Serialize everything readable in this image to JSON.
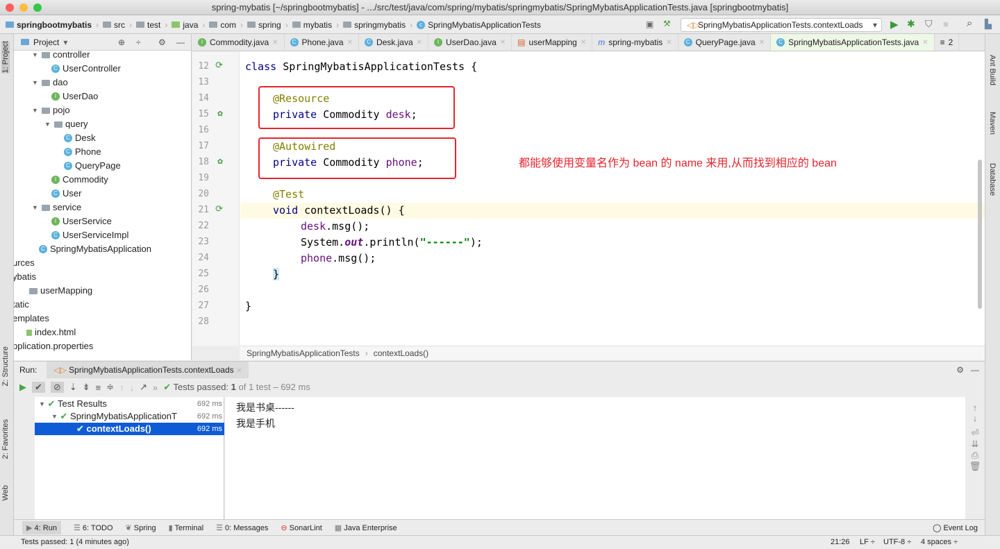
{
  "window": {
    "title": "spring-mybatis [~/springbootmybatis] - .../src/test/java/com/spring/mybatis/springmybatis/SpringMybatisApplicationTests.java [springbootmybatis]"
  },
  "nav": {
    "crumbs": [
      "springbootmybatis",
      "src",
      "test",
      "java",
      "com",
      "spring",
      "mybatis",
      "springmybatis",
      "SpringMybatisApplicationTests"
    ],
    "run_config": "SpringMybatisApplicationTests.contextLoads"
  },
  "left_strip": {
    "project": "1: Project",
    "structure": "Z: Structure",
    "favorites": "2: Favorites",
    "web": "Web"
  },
  "right_strip": {
    "ant": "Ant Build",
    "maven": "Maven",
    "database": "Database"
  },
  "project": {
    "header": "Project",
    "items": [
      {
        "label": "controller",
        "type": "folder",
        "indent": 1,
        "open": true
      },
      {
        "label": "UserController",
        "type": "class",
        "indent": 2
      },
      {
        "label": "dao",
        "type": "folder",
        "indent": 1,
        "open": true
      },
      {
        "label": "UserDao",
        "type": "interface",
        "indent": 2
      },
      {
        "label": "pojo",
        "type": "folder",
        "indent": 1,
        "open": true
      },
      {
        "label": "query",
        "type": "folder",
        "indent": 2,
        "open": true
      },
      {
        "label": "Desk",
        "type": "class",
        "indent": 3
      },
      {
        "label": "Phone",
        "type": "class",
        "indent": 3
      },
      {
        "label": "QueryPage",
        "type": "class",
        "indent": 3
      },
      {
        "label": "Commodity",
        "type": "interface",
        "indent": 2
      },
      {
        "label": "User",
        "type": "class",
        "indent": 2
      },
      {
        "label": "service",
        "type": "folder",
        "indent": 1,
        "open": true
      },
      {
        "label": "UserService",
        "type": "interface",
        "indent": 2
      },
      {
        "label": "UserServiceImpl",
        "type": "class",
        "indent": 2
      },
      {
        "label": "SpringMybatisApplication",
        "type": "class",
        "indent": 1
      },
      {
        "label": "urces",
        "type": "text",
        "indent": 0
      },
      {
        "label": "ybatis",
        "type": "text",
        "indent": 0
      },
      {
        "label": "userMapping",
        "type": "folder",
        "indent": 0
      },
      {
        "label": "tatic",
        "type": "text",
        "indent": 0
      },
      {
        "label": "emplates",
        "type": "text",
        "indent": 0
      },
      {
        "label": "index.html",
        "type": "file",
        "indent": 0
      },
      {
        "label": "pplication.properties",
        "type": "text",
        "indent": 0
      }
    ]
  },
  "tabs": [
    "Commodity.java",
    "Phone.java",
    "Desk.java",
    "UserDao.java",
    "userMapping",
    "spring-mybatis",
    "QueryPage.java",
    "SpringMybatisApplicationTests.java"
  ],
  "tabs_overflow": "2",
  "editor": {
    "lines": [
      "12",
      "13",
      "14",
      "15",
      "16",
      "17",
      "18",
      "19",
      "20",
      "21",
      "22",
      "23",
      "24",
      "25",
      "26",
      "27",
      "28"
    ],
    "code": {
      "l12a": "class ",
      "l12b": "SpringMybatisApplicationTests {",
      "l14": "@Resource",
      "l15a": "private ",
      "l15b": "Commodity ",
      "l15c": "desk",
      "l17": "@Autowired",
      "l18a": "private ",
      "l18b": "Commodity ",
      "l18c": "phone",
      "l20": "@Test",
      "l21a": "void ",
      "l21b": "contextLoads() {",
      "l22a": "desk",
      "l22b": ".msg();",
      "l23a": "System.",
      "l23b": "out",
      "l23c": ".println(",
      "l23d": "\"------\"",
      "l23e": ");",
      "l24a": "phone",
      "l24b": ".msg();",
      "l25": "}",
      "l27": "}",
      "semi": ";"
    },
    "annotation_note": "都能够使用变量名作为 bean 的 name 来用,从而找到相应的 bean",
    "breadcrumb": [
      "SpringMybatisApplicationTests",
      "contextLoads()"
    ]
  },
  "run": {
    "label": "Run:",
    "tab": "SpringMybatisApplicationTests.contextLoads",
    "status_prefix": "Tests passed: ",
    "status_count": "1",
    "status_suffix": " of 1 test – 692 ms",
    "results": [
      {
        "label": "Test Results",
        "time": "692 ms"
      },
      {
        "label": "SpringMybatisApplicationT",
        "time": "692 ms"
      },
      {
        "label": "contextLoads()",
        "time": "692 ms"
      }
    ],
    "console": [
      "我是书桌------",
      "我是手机"
    ]
  },
  "bottom_tools": [
    "4: Run",
    "6: TODO",
    "Spring",
    "Terminal",
    "0: Messages",
    "SonarLint",
    "Java Enterprise"
  ],
  "event_log": "Event Log",
  "status": {
    "message": "Tests passed: 1 (4 minutes ago)",
    "position": "21:26",
    "line_sep": "LF ÷",
    "encoding": "UTF-8 ÷",
    "indent": "4 spaces ÷"
  }
}
